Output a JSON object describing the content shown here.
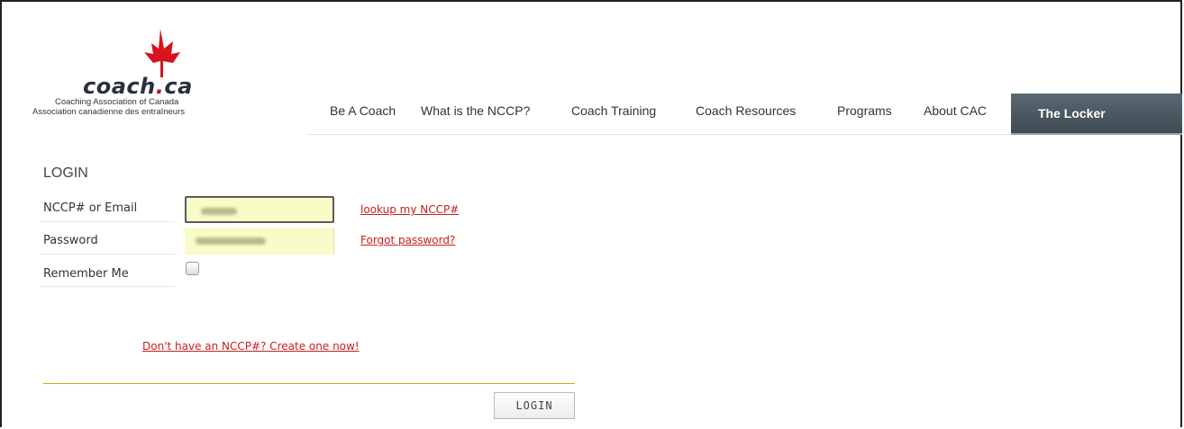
{
  "logo": {
    "wordmark_left": "coach",
    "wordmark_dot": ".",
    "wordmark_right": "ca",
    "line1": "Coaching Association of Canada",
    "line2": "Association canadienne des entraîneurs"
  },
  "nav": {
    "items": [
      "Be A Coach",
      "What is the NCCP?",
      "Coach Training",
      "Coach Resources",
      "Programs",
      "About CAC"
    ],
    "locker": "The Locker"
  },
  "form": {
    "title": "LOGIN",
    "nccp_label": "NCCP# or Email",
    "password_label": "Password",
    "remember_label": "Remember Me",
    "lookup_link": "lookup my NCCP#",
    "forgot_link": "Forgot password?",
    "create_link": "Don't have an NCCP#? Create one now!",
    "submit": "LOGIN"
  },
  "colors": {
    "accent": "#c8102e",
    "input_bg": "#fafcc8",
    "divider": "#d4a017",
    "locker_bg": "#46535c"
  }
}
